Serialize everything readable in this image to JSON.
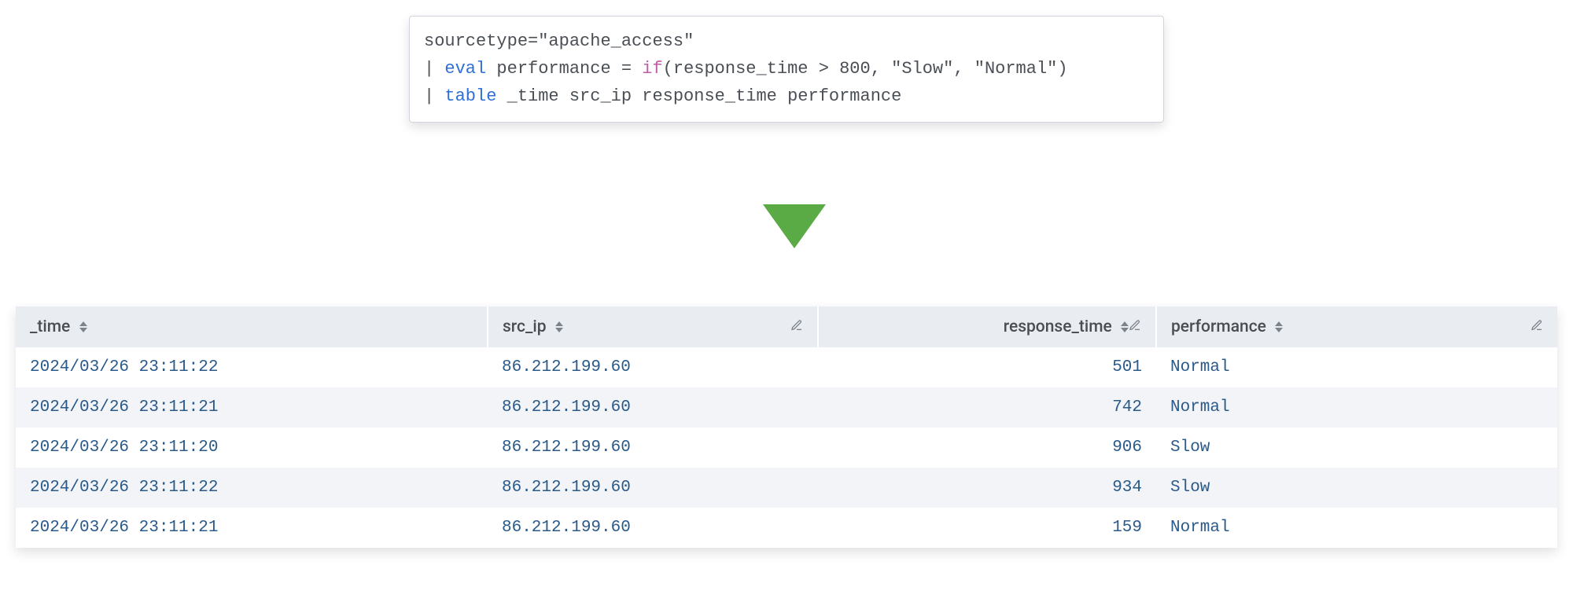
{
  "query": {
    "line1_pre": "sourcetype=",
    "line1_val": "\"apache_access\"",
    "line2_pipe": "| ",
    "line2_cmd": "eval",
    "line2_mid": " performance = ",
    "line2_fn": "if",
    "line2_rest": "(response_time > 800, \"Slow\", \"Normal\")",
    "line3_pipe": "| ",
    "line3_cmd": "table",
    "line3_rest": " _time src_ip response_time performance"
  },
  "columns": {
    "time": "_time",
    "src_ip": "src_ip",
    "response_time": "response_time",
    "performance": "performance"
  },
  "rows": [
    {
      "time": "2024/03/26 23:11:22",
      "src_ip": "86.212.199.60",
      "response_time": "501",
      "performance": "Normal"
    },
    {
      "time": "2024/03/26 23:11:21",
      "src_ip": "86.212.199.60",
      "response_time": "742",
      "performance": "Normal"
    },
    {
      "time": "2024/03/26 23:11:20",
      "src_ip": "86.212.199.60",
      "response_time": "906",
      "performance": "Slow"
    },
    {
      "time": "2024/03/26 23:11:22",
      "src_ip": "86.212.199.60",
      "response_time": "934",
      "performance": "Slow"
    },
    {
      "time": "2024/03/26 23:11:21",
      "src_ip": "86.212.199.60",
      "response_time": "159",
      "performance": "Normal"
    }
  ]
}
